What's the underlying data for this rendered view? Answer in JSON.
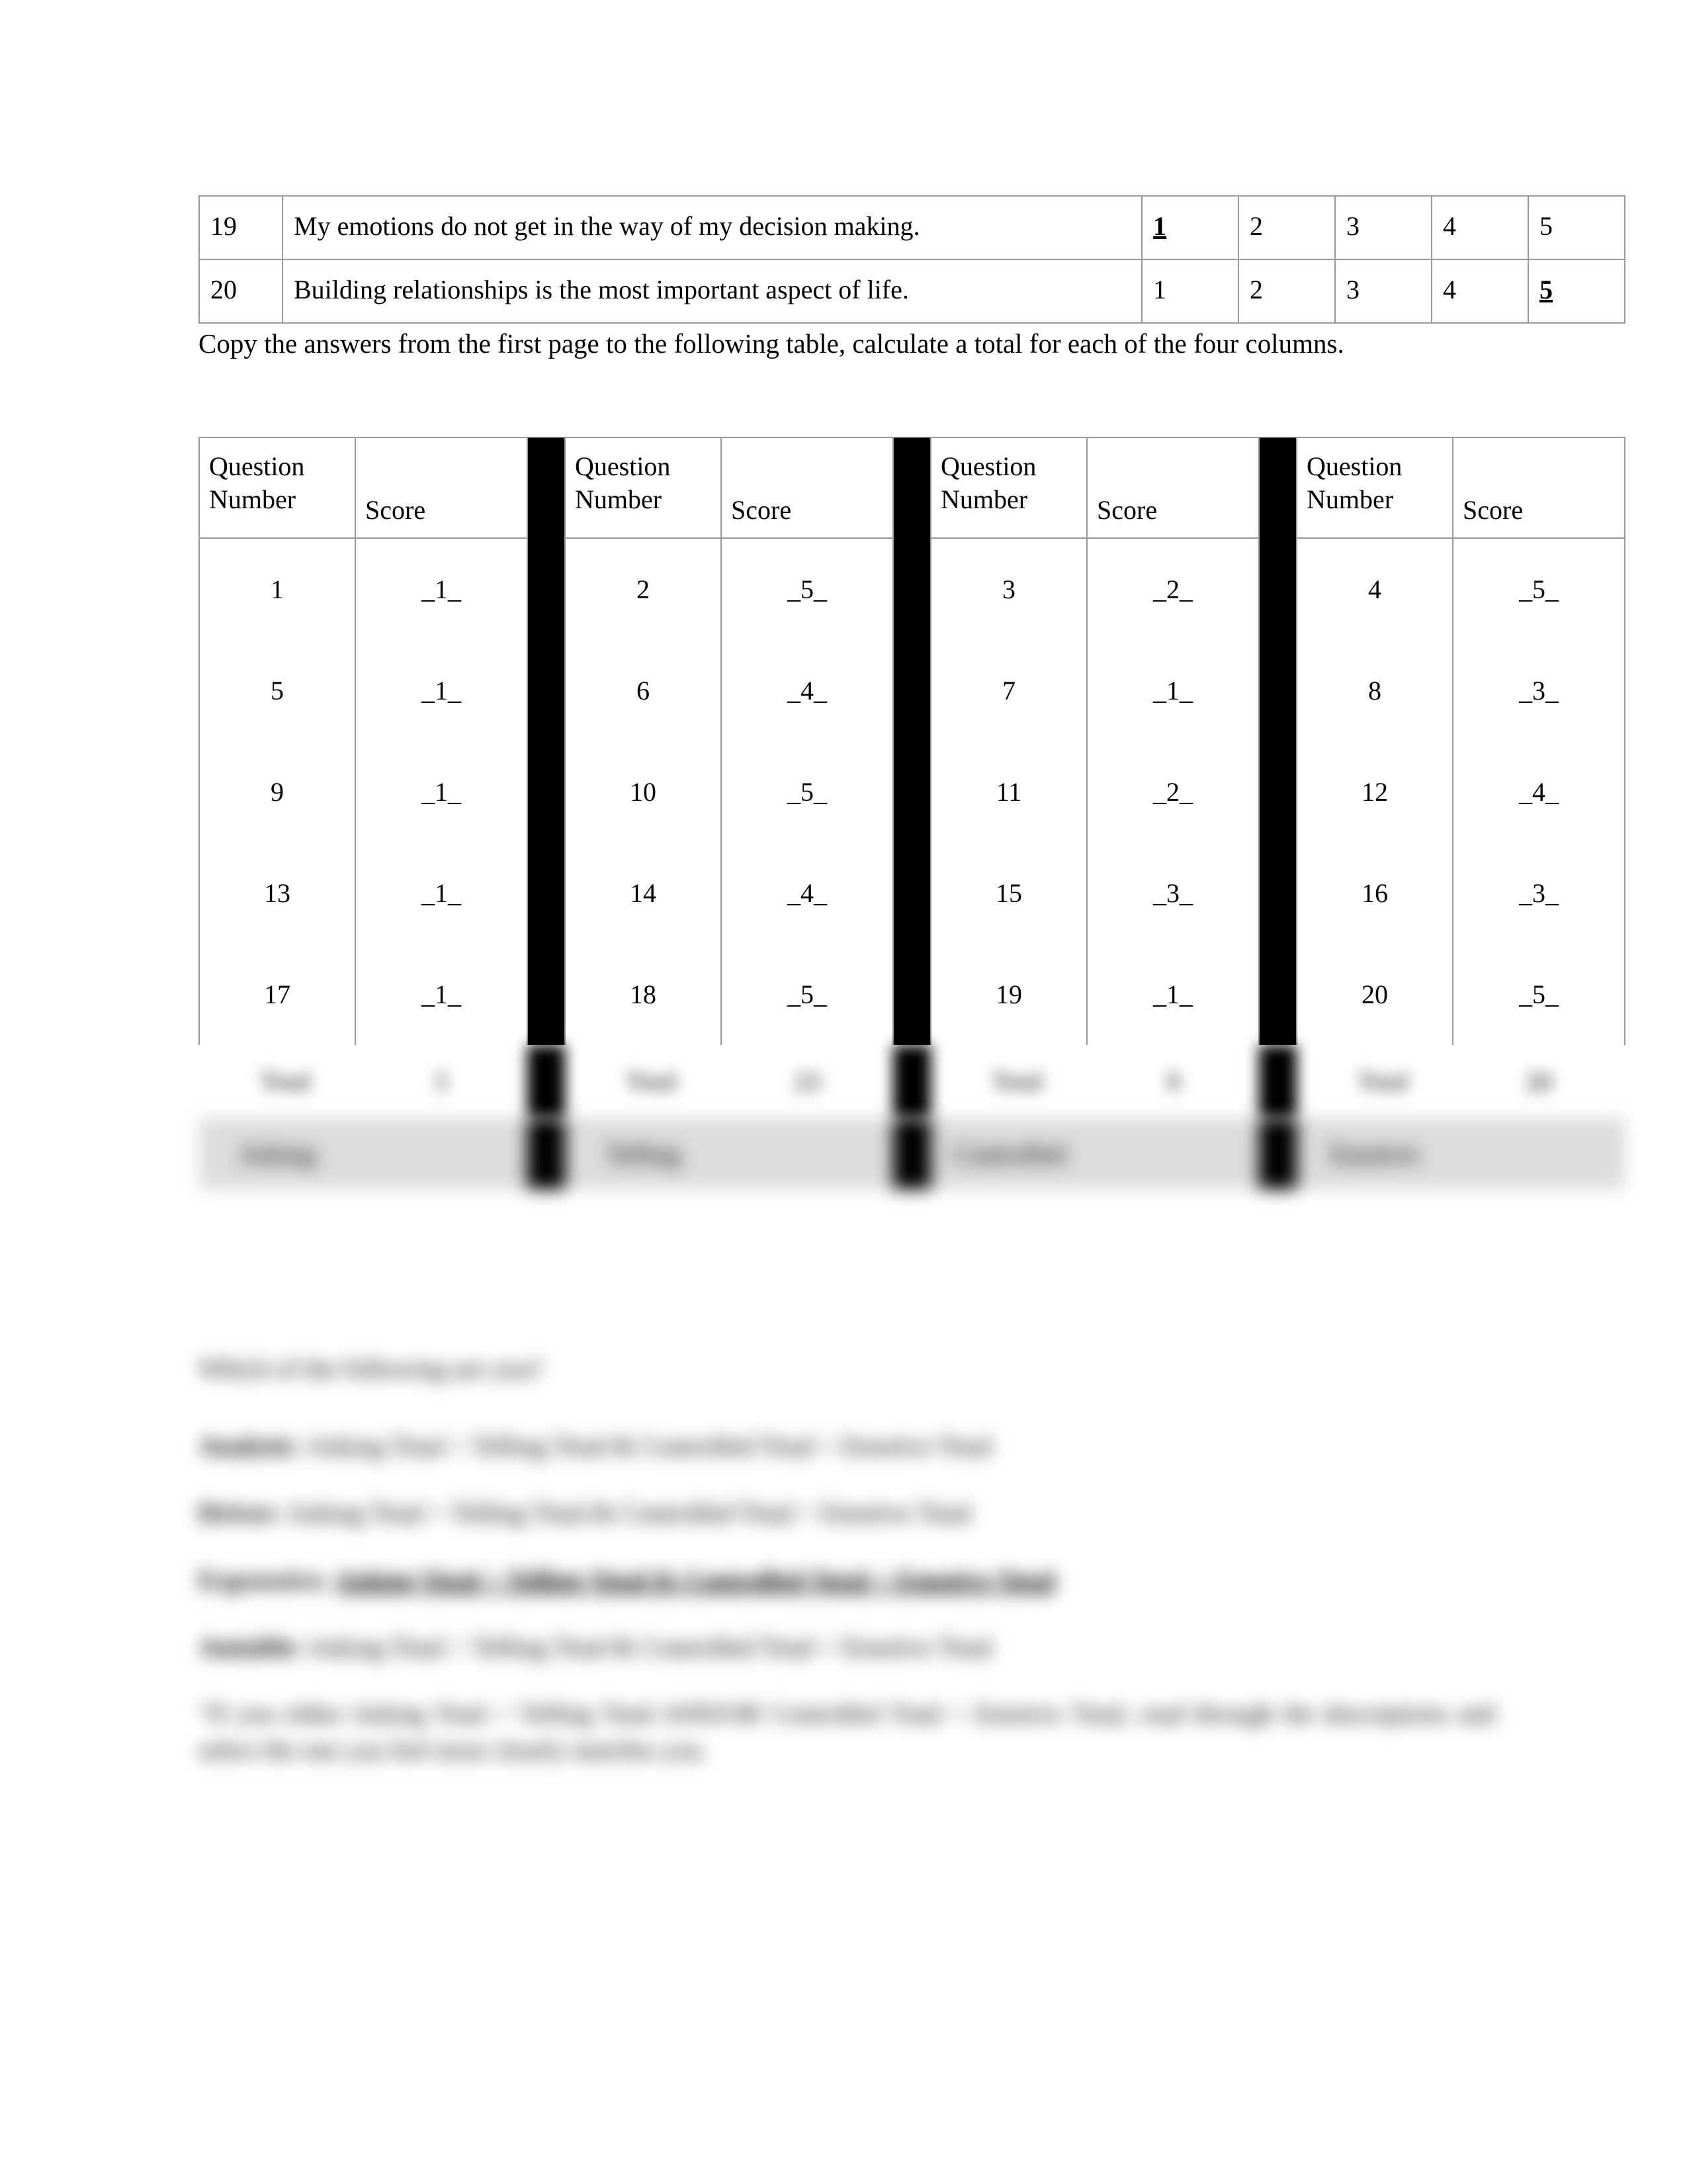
{
  "questionnaire": {
    "scale": [
      "1",
      "2",
      "3",
      "4",
      "5"
    ],
    "rows": [
      {
        "number": "19",
        "text": "My emotions do not get in the way of my decision making.",
        "selected": "1"
      },
      {
        "number": "20",
        "text": "Building relationships is the most important aspect of life.",
        "selected": "5"
      }
    ]
  },
  "instruction": "Copy the answers from the first page to the following table, calculate a total for each of the four columns.",
  "score_table": {
    "headers": {
      "question_number_line1": "Question",
      "question_number_line2": "Number",
      "score": "Score"
    },
    "groups": [
      {
        "label": "Asking",
        "total_label": "Total",
        "total": "5",
        "entries": [
          {
            "question": "1",
            "score": "_1_"
          },
          {
            "question": "5",
            "score": "_1_"
          },
          {
            "question": "9",
            "score": "_1_"
          },
          {
            "question": "13",
            "score": "_1_"
          },
          {
            "question": "17",
            "score": "_1_"
          }
        ]
      },
      {
        "label": "Telling",
        "total_label": "Total",
        "total": "23",
        "entries": [
          {
            "question": "2",
            "score": "_5_"
          },
          {
            "question": "6",
            "score": "_4_"
          },
          {
            "question": "10",
            "score": "_5_"
          },
          {
            "question": "14",
            "score": "_4_"
          },
          {
            "question": "18",
            "score": "_5_"
          }
        ]
      },
      {
        "label": "Controlled",
        "total_label": "Total",
        "total": "9",
        "entries": [
          {
            "question": "3",
            "score": "_2_"
          },
          {
            "question": "7",
            "score": "_1_"
          },
          {
            "question": "11",
            "score": "_2_"
          },
          {
            "question": "15",
            "score": "_3_"
          },
          {
            "question": "19",
            "score": "_1_"
          }
        ]
      },
      {
        "label": "Emotive",
        "total_label": "Total",
        "total": "20",
        "entries": [
          {
            "question": "4",
            "score": "_5_"
          },
          {
            "question": "8",
            "score": "_3_"
          },
          {
            "question": "12",
            "score": "_4_"
          },
          {
            "question": "16",
            "score": "_3_"
          },
          {
            "question": "20",
            "score": "_5_"
          }
        ]
      }
    ]
  },
  "bottom": {
    "lead": "Which of the following are you?",
    "options": [
      {
        "label": "Analytic:",
        "text": "Asking Total > Telling Total & Controlled Total > Emotive Total",
        "selected": false
      },
      {
        "label": "Driver:",
        "text": "Asking Total < Telling Total & Controlled Total > Emotive Total",
        "selected": false
      },
      {
        "label": "Expressive:",
        "text": "Asking Total < Telling Total & Controlled Total < Emotive Total",
        "selected": true
      },
      {
        "label": "Amiable:",
        "text": "Asking Total > Telling Total & Controlled Total < Emotive Total",
        "selected": false
      }
    ],
    "note": "“If you either Asking Total < Telling Total AND/OR Controlled Total < Emotive Total, read through the descriptions and select the one you feel most closely matches you."
  }
}
